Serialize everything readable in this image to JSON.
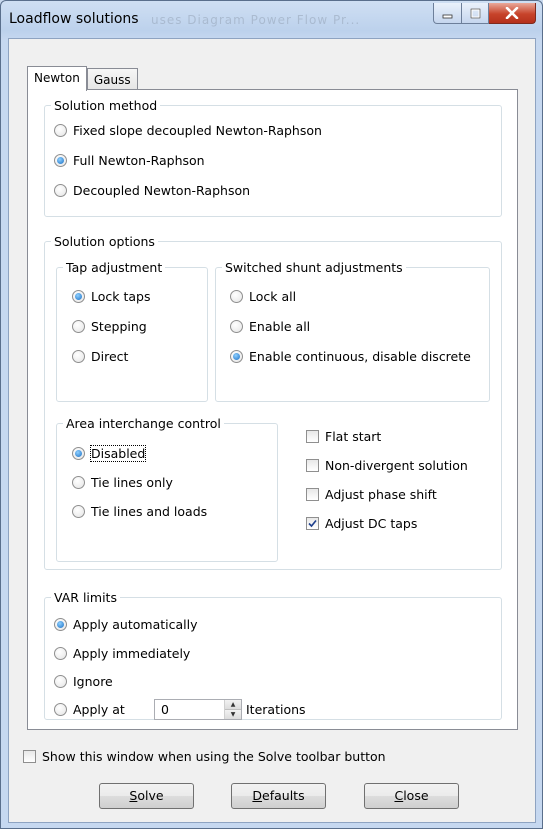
{
  "window": {
    "title": "Loadflow solutions",
    "ghost_title": "uses Diagram Power Flow Pr..."
  },
  "tabs": [
    {
      "label": "Newton",
      "selected": true
    },
    {
      "label": "Gauss",
      "selected": false
    }
  ],
  "solution_method": {
    "legend": "Solution method",
    "options": [
      {
        "label": "Fixed slope decoupled Newton-Raphson",
        "selected": false
      },
      {
        "label": "Full Newton-Raphson",
        "selected": true
      },
      {
        "label": "Decoupled Newton-Raphson",
        "selected": false
      }
    ]
  },
  "solution_options": {
    "legend": "Solution options",
    "tap_adjustment": {
      "legend": "Tap adjustment",
      "options": [
        {
          "label": "Lock taps",
          "selected": true
        },
        {
          "label": "Stepping",
          "selected": false
        },
        {
          "label": "Direct",
          "selected": false
        }
      ]
    },
    "switched_shunt": {
      "legend": "Switched shunt adjustments",
      "options": [
        {
          "label": "Lock all",
          "selected": false
        },
        {
          "label": "Enable all",
          "selected": false
        },
        {
          "label": "Enable continuous, disable discrete",
          "selected": true
        }
      ]
    },
    "area_interchange": {
      "legend": "Area interchange control",
      "options": [
        {
          "label": "Disabled",
          "selected": true
        },
        {
          "label": "Tie lines only",
          "selected": false
        },
        {
          "label": "Tie lines and loads",
          "selected": false
        }
      ]
    },
    "checkboxes": [
      {
        "label": "Flat start",
        "checked": false
      },
      {
        "label": "Non-divergent solution",
        "checked": false
      },
      {
        "label": "Adjust phase shift",
        "checked": false
      },
      {
        "label": "Adjust DC taps",
        "checked": true
      }
    ]
  },
  "var_limits": {
    "legend": "VAR limits",
    "options": [
      {
        "label": "Apply automatically",
        "selected": true
      },
      {
        "label": "Apply immediately",
        "selected": false
      },
      {
        "label": "Ignore",
        "selected": false
      },
      {
        "label": "Apply at",
        "selected": false
      }
    ],
    "iterations_value": "0",
    "iterations_label": "Iterations"
  },
  "show_window_checkbox": {
    "label": "Show this window when using the Solve toolbar button",
    "checked": false
  },
  "buttons": {
    "solve": {
      "mnemonic": "S",
      "rest": "olve"
    },
    "defaults": {
      "mnemonic": "D",
      "rest": "efaults"
    },
    "close": {
      "mnemonic": "C",
      "rest": "lose"
    }
  }
}
